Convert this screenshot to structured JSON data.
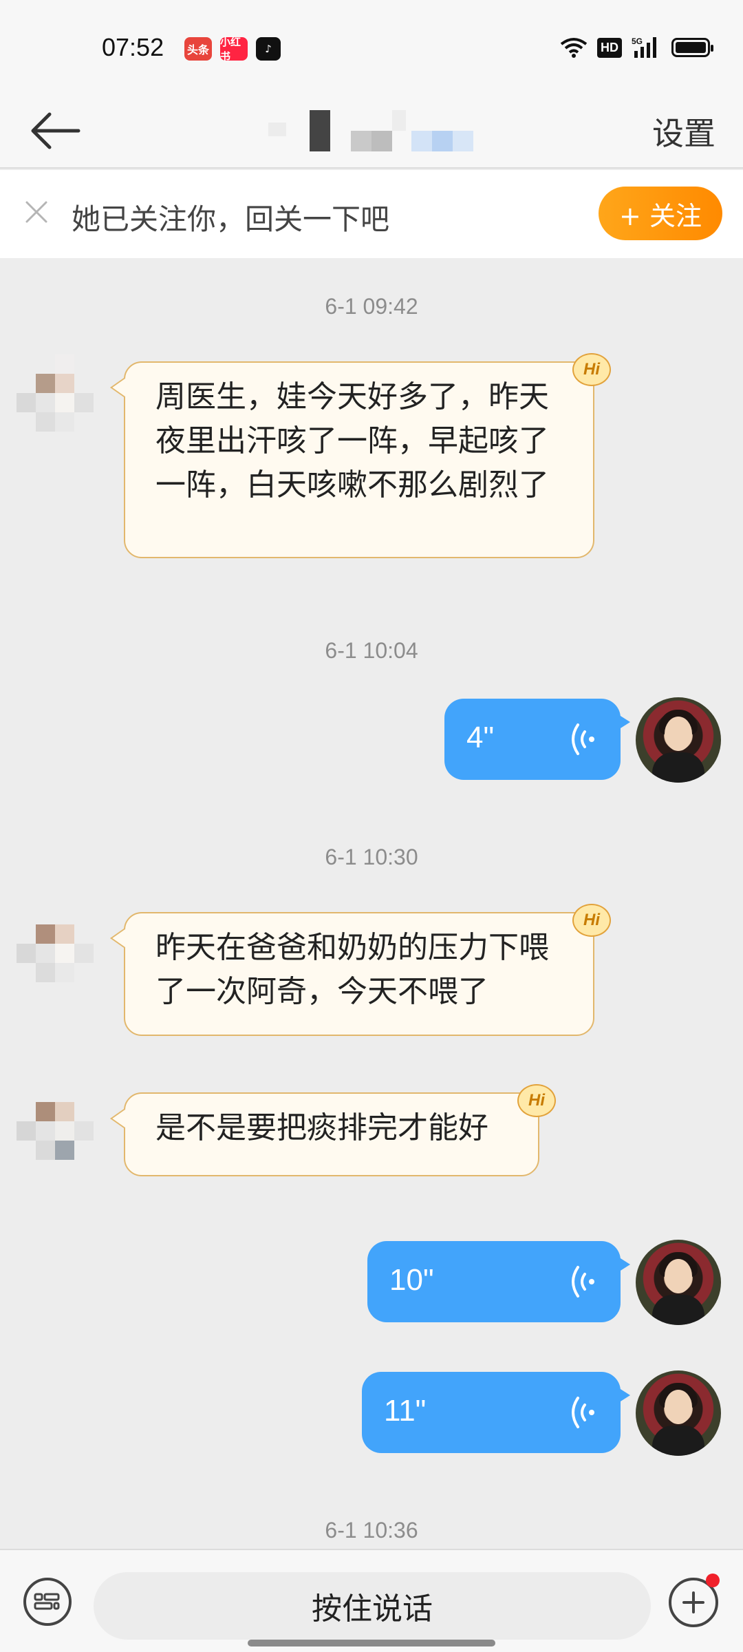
{
  "status_bar": {
    "time": "07:52",
    "app_badges": [
      "头条",
      "小红书",
      "♪"
    ],
    "network": "5G",
    "hd_label": "HD",
    "icons": [
      "wifi-icon",
      "hd-icon",
      "signal-icon",
      "battery-icon"
    ]
  },
  "header": {
    "back_icon": "arrow-left-icon",
    "settings_label": "设置"
  },
  "follow_bar": {
    "text": "她已关注你，回关一下吧",
    "button_label": "+ 关注",
    "close_icon": "close-icon"
  },
  "messages": {
    "t1": "6-1 09:42",
    "m1": "周医生，娃今天好多了，昨天夜里出汗咳了一阵，早起咳了一阵，白天咳嗽不那么剧烈了",
    "t2": "6-1 10:04",
    "v1": "4\"",
    "t3": "6-1 10:30",
    "m2": "昨天在爸爸和奶奶的压力下喂了一次阿奇，今天不喂了",
    "m3": "是不是要把痰排完才能好",
    "v2": "10\"",
    "v3": "11\"",
    "t4": "6-1 10:36",
    "hi_badge": "Hi"
  },
  "bottom_bar": {
    "hold_to_talk": "按住说话",
    "keyboard_icon": "keyboard-icon",
    "plus_icon": "plus-icon"
  },
  "colors": {
    "accent_orange": "#ff9a0d",
    "voice_blue": "#42a4fb",
    "incoming_bubble_bg": "#fffaf0",
    "incoming_bubble_border": "#e2b76c",
    "chat_bg": "#ededed"
  }
}
